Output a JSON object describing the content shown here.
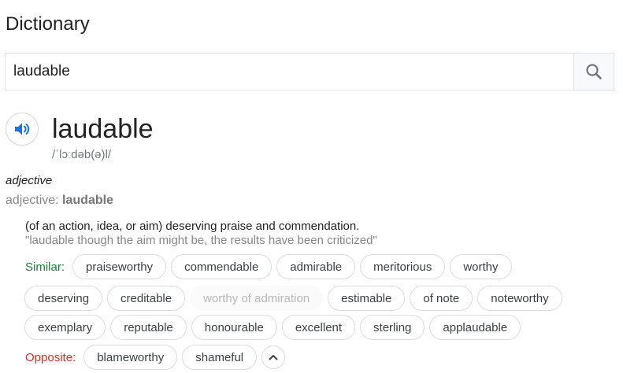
{
  "header": {
    "title": "Dictionary"
  },
  "search": {
    "value": "laudable"
  },
  "entry": {
    "word": "laudable",
    "phonetic": "/ˈlɔːdəb(ə)l/",
    "pos": "adjective",
    "pos_prefix": "adjective: ",
    "pos_word": "laudable",
    "definition": "(of an action, idea, or aim) deserving praise and commendation.",
    "example": "\"laudable though the aim might be, the results have been criticized\""
  },
  "similar": {
    "label": "Similar:",
    "rows": [
      [
        "praiseworthy",
        "commendable",
        "admirable",
        "meritorious",
        "worthy"
      ],
      [
        "deserving",
        "creditable",
        "worthy of admiration",
        "estimable",
        "of note",
        "noteworthy"
      ],
      [
        "exemplary",
        "reputable",
        "honourable",
        "excellent",
        "sterling",
        "applaudable"
      ]
    ],
    "disabled": [
      "worthy of admiration"
    ]
  },
  "opposite": {
    "label": "Opposite:",
    "words": [
      "blameworthy",
      "shameful"
    ]
  },
  "colors": {
    "similar_label": "#188038",
    "opposite_label": "#d93025",
    "speaker_blue": "#1a73e8"
  },
  "icons": {
    "search": "search-icon",
    "speaker": "speaker-icon",
    "collapse": "chevron-up-icon"
  }
}
